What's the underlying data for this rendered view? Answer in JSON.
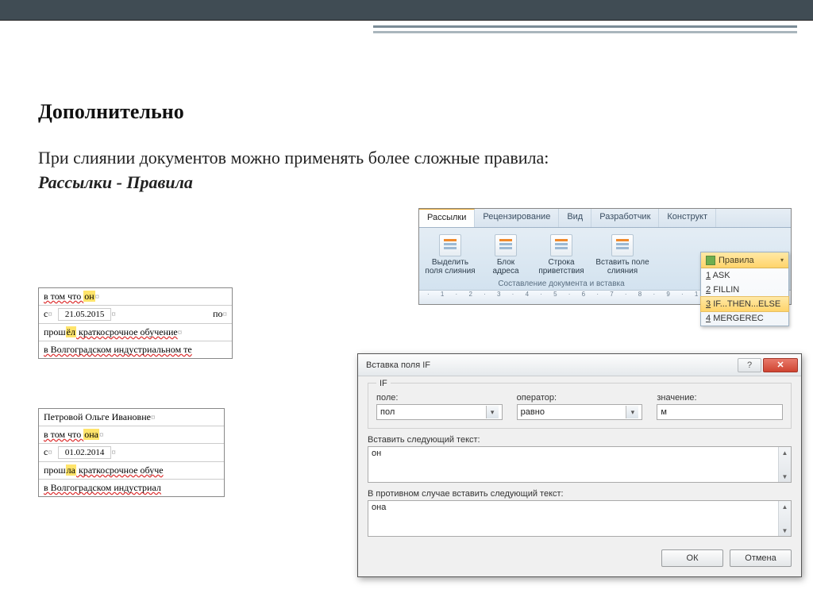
{
  "heading": "Дополнительно",
  "intro_line": "При слиянии документов можно применять более сложные правила:",
  "intro_em": "Рассылки - Правила",
  "snippet1": {
    "l1_pre": "в том что ",
    "l1_hl": "он",
    "l2_pre": "с",
    "l2_date": "21.05.2015",
    "l2_post": "по",
    "l3_pre": "прош",
    "l3_hl": "ёл",
    "l3_post": " краткосрочное обучение",
    "l4": "в Волгоградском индустриальном те"
  },
  "snippet2": {
    "l0": "Петровой Ольге Ивановне",
    "l1_pre": "в том что ",
    "l1_hl": "она",
    "l2_pre": "с",
    "l2_date": "01.02.2014",
    "l3_pre": "прош",
    "l3_hl": "ла",
    "l3_post": " краткосрочное обуче",
    "l4": "в Волгоградском индустриал"
  },
  "ribbon": {
    "tabs": [
      "Рассылки",
      "Рецензирование",
      "Вид",
      "Разработчик",
      "Конструкт"
    ],
    "active_tab_index": 0,
    "buttons": [
      {
        "line1": "Выделить",
        "line2": "поля слияния"
      },
      {
        "line1": "Блок",
        "line2": "адреса"
      },
      {
        "line1": "Строка",
        "line2": "приветствия"
      },
      {
        "line1": "Вставить поле",
        "line2": "слияния"
      }
    ],
    "group_label": "Составление документа и вставка",
    "rules_button": "Правила",
    "rules_items": [
      "1 ASK",
      "2 FILLIN",
      "3 IF...THEN...ELSE",
      "4 MERGEREC"
    ],
    "rules_highlight_index": 2,
    "ruler": "· 1 · 2 · 3 · 4 · 5 · 6 · 7 · 8 · 9 · 10 · 11 · 12 ·"
  },
  "dialog": {
    "title": "Вставка поля IF",
    "group": "IF",
    "field_label": "поле:",
    "field_value": "пол",
    "op_label": "оператор:",
    "op_value": "равно",
    "val_label": "значение:",
    "val_value": "м",
    "then_label": "Вставить следующий текст:",
    "then_value": "он",
    "else_label": "В противном случае вставить следующий текст:",
    "else_value": "она",
    "ok": "ОК",
    "cancel": "Отмена"
  }
}
